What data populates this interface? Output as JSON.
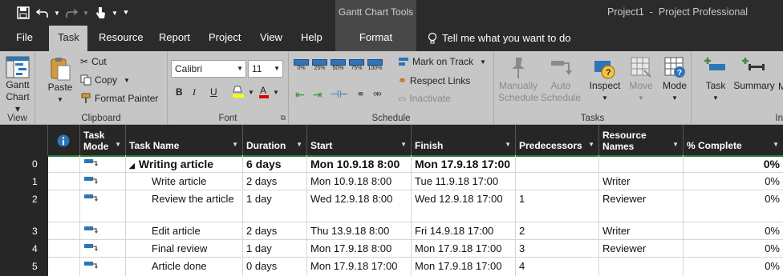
{
  "titlebar": {
    "context_tab_group": "Gantt Chart Tools",
    "app_title": "Project1  -  Project Professional"
  },
  "tabs": [
    {
      "label": "File"
    },
    {
      "label": "Task"
    },
    {
      "label": "Resource"
    },
    {
      "label": "Report"
    },
    {
      "label": "Project"
    },
    {
      "label": "View"
    },
    {
      "label": "Help"
    },
    {
      "label": "Format"
    }
  ],
  "tell_me": "Tell me what you want to do",
  "ribbon": {
    "view": {
      "label": "View",
      "gantt": "Gantt",
      "chart": "Chart"
    },
    "clipboard": {
      "label": "Clipboard",
      "paste": "Paste",
      "cut": "Cut",
      "copy": "Copy",
      "format_painter": "Format Painter"
    },
    "font": {
      "label": "Font",
      "font_name": "Calibri",
      "font_size": "11",
      "bold": "B",
      "italic": "I",
      "underline": "U"
    },
    "schedule": {
      "label": "Schedule",
      "pct": [
        "0%",
        "25%",
        "50%",
        "75%",
        "100%"
      ],
      "mark_on_track": "Mark on Track",
      "respect_links": "Respect Links",
      "inactivate": "Inactivate"
    },
    "tasks": {
      "label": "Tasks",
      "manually": "Manually",
      "schedule1": "Schedule",
      "auto": "Auto",
      "schedule2": "Schedule",
      "inspect": "Inspect",
      "move": "Move",
      "mode": "Mode"
    },
    "insert": {
      "label": "In",
      "task": "Task",
      "summary": "Summary",
      "milestone_partial": "M"
    }
  },
  "grid": {
    "columns": {
      "task_mode_1": "Task",
      "task_mode_2": "Mode",
      "task_name": "Task Name",
      "duration": "Duration",
      "start": "Start",
      "finish": "Finish",
      "predecessors": "Predecessors",
      "resource_1": "Resource",
      "resource_2": "Names",
      "complete": "% Complete"
    },
    "rows": [
      {
        "id": "0",
        "name": "Writing article",
        "duration": "6 days",
        "start": "Mon 10.9.18 8:00",
        "finish": "Mon 17.9.18 17:00",
        "pred": "",
        "res": "",
        "complete": "0%"
      },
      {
        "id": "1",
        "name": "Write article",
        "duration": "2 days",
        "start": "Mon 10.9.18 8:00",
        "finish": "Tue 11.9.18 17:00",
        "pred": "",
        "res": "Writer",
        "complete": "0%"
      },
      {
        "id": "2",
        "name": "Review the article",
        "duration": "1 day",
        "start": "Wed 12.9.18 8:00",
        "finish": "Wed 12.9.18 17:00",
        "pred": "1",
        "res": "Reviewer",
        "complete": "0%"
      },
      {
        "id": "3",
        "name": "Edit article",
        "duration": "2 days",
        "start": "Thu 13.9.18 8:00",
        "finish": "Fri 14.9.18 17:00",
        "pred": "2",
        "res": "Writer",
        "complete": "0%"
      },
      {
        "id": "4",
        "name": "Final review",
        "duration": "1 day",
        "start": "Mon 17.9.18 8:00",
        "finish": "Mon 17.9.18 17:00",
        "pred": "3",
        "res": "Reviewer",
        "complete": "0%"
      },
      {
        "id": "5",
        "name": "Article done",
        "duration": "0 days",
        "start": "Mon 17.9.18 17:00",
        "finish": "Mon 17.9.18 17:00",
        "pred": "4",
        "res": "",
        "complete": "0%"
      }
    ]
  },
  "colors": {
    "titlebar": "#2b2b2b",
    "ribbon": "#c6c6c6",
    "header": "#262626",
    "accent_green": "#2e7d32",
    "icon_blue": "#2e75b6"
  }
}
